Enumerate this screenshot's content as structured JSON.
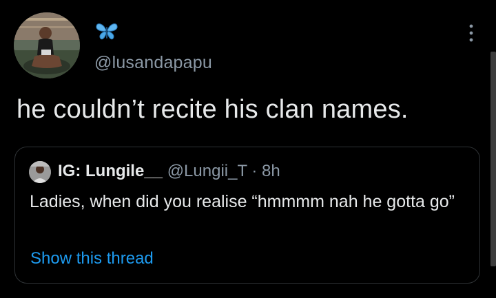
{
  "author": {
    "display_name_icon": "butterfly-emoji",
    "handle": "@lusandapapu"
  },
  "tweet": {
    "text": "he couldn’t recite his clan names."
  },
  "quoted_tweet": {
    "display_name": "IG: Lungile__",
    "handle_time": "@Lungii_T · 8h",
    "text": "Ladies, when did you realise “hmmmm nah he gotta go”",
    "show_thread_label": "Show this thread"
  },
  "colors": {
    "background": "#000000",
    "text_primary": "#e7e9ea",
    "text_secondary": "#8b98a5",
    "link": "#1d9bf0",
    "border": "#2f3336",
    "butterfly": "#4aa8e8"
  }
}
